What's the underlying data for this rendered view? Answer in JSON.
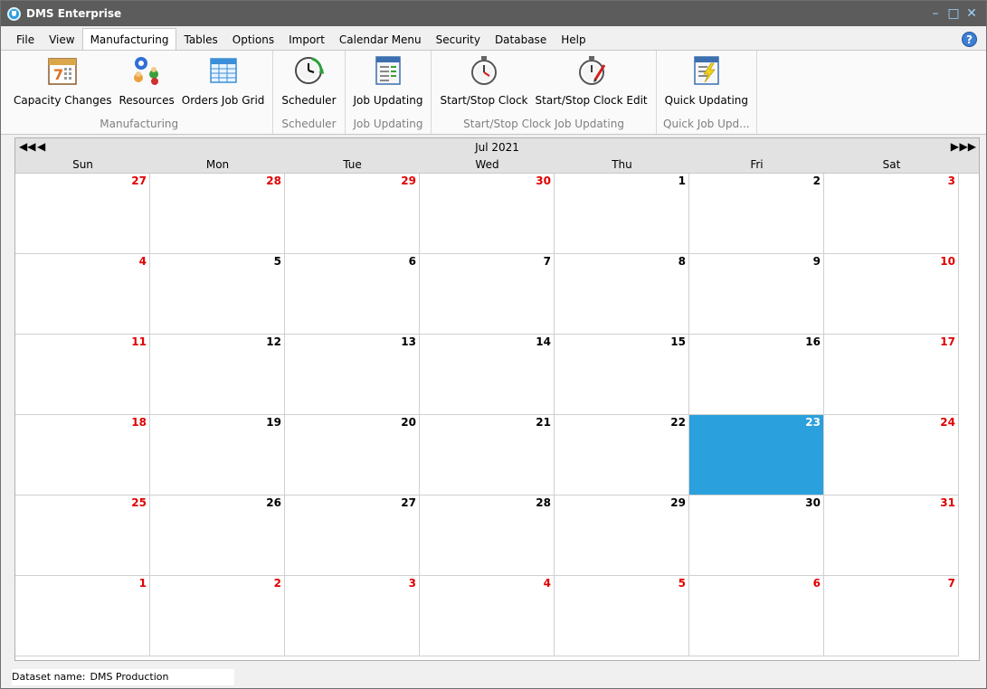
{
  "window": {
    "title": "DMS Enterprise"
  },
  "menu": [
    {
      "key": "file",
      "label": "File"
    },
    {
      "key": "view",
      "label": "View"
    },
    {
      "key": "manufacturing",
      "label": "Manufacturing",
      "active": true
    },
    {
      "key": "tables",
      "label": "Tables"
    },
    {
      "key": "options",
      "label": "Options"
    },
    {
      "key": "import",
      "label": "Import"
    },
    {
      "key": "calendar-menu",
      "label": "Calendar Menu"
    },
    {
      "key": "security",
      "label": "Security"
    },
    {
      "key": "database",
      "label": "Database"
    },
    {
      "key": "help",
      "label": "Help"
    }
  ],
  "ribbon": {
    "groups": [
      {
        "label": "Manufacturing",
        "buttons": [
          {
            "name": "capacity-changes",
            "label": "Capacity Changes",
            "icon": "calendar-icon"
          },
          {
            "name": "resources",
            "label": "Resources",
            "icon": "gears-people-icon"
          },
          {
            "name": "orders-job-grid",
            "label": "Orders Job Grid",
            "icon": "grid-icon"
          }
        ]
      },
      {
        "label": "Scheduler",
        "buttons": [
          {
            "name": "scheduler",
            "label": "Scheduler",
            "icon": "clock-arrow-icon"
          }
        ]
      },
      {
        "label": "Job Updating",
        "buttons": [
          {
            "name": "job-updating",
            "label": "Job Updating",
            "icon": "document-list-icon"
          }
        ]
      },
      {
        "label": "Start/Stop Clock Job Updating",
        "buttons": [
          {
            "name": "start-stop-clock",
            "label": "Start/Stop Clock",
            "icon": "stopwatch-icon"
          },
          {
            "name": "start-stop-clock-edit",
            "label": "Start/Stop Clock Edit",
            "icon": "stopwatch-edit-icon"
          }
        ]
      },
      {
        "label": "Quick Job Upd...",
        "buttons": [
          {
            "name": "quick-updating",
            "label": "Quick Updating",
            "icon": "lightning-document-icon"
          }
        ]
      }
    ]
  },
  "calendar": {
    "month_label": "Jul 2021",
    "days_of_week": [
      "Sun",
      "Mon",
      "Tue",
      "Wed",
      "Thu",
      "Fri",
      "Sat"
    ],
    "weeks": [
      [
        {
          "d": "27",
          "red": true
        },
        {
          "d": "28",
          "red": true
        },
        {
          "d": "29",
          "red": true
        },
        {
          "d": "30",
          "red": true
        },
        {
          "d": "1"
        },
        {
          "d": "2"
        },
        {
          "d": "3",
          "red": true
        }
      ],
      [
        {
          "d": "4",
          "red": true
        },
        {
          "d": "5"
        },
        {
          "d": "6"
        },
        {
          "d": "7"
        },
        {
          "d": "8"
        },
        {
          "d": "9"
        },
        {
          "d": "10",
          "red": true
        }
      ],
      [
        {
          "d": "11",
          "red": true
        },
        {
          "d": "12"
        },
        {
          "d": "13"
        },
        {
          "d": "14"
        },
        {
          "d": "15"
        },
        {
          "d": "16"
        },
        {
          "d": "17",
          "red": true
        }
      ],
      [
        {
          "d": "18",
          "red": true
        },
        {
          "d": "19"
        },
        {
          "d": "20"
        },
        {
          "d": "21"
        },
        {
          "d": "22"
        },
        {
          "d": "23",
          "today": true
        },
        {
          "d": "24",
          "red": true
        }
      ],
      [
        {
          "d": "25",
          "red": true
        },
        {
          "d": "26"
        },
        {
          "d": "27"
        },
        {
          "d": "28"
        },
        {
          "d": "29"
        },
        {
          "d": "30"
        },
        {
          "d": "31",
          "red": true
        }
      ],
      [
        {
          "d": "1",
          "red": true
        },
        {
          "d": "2",
          "red": true
        },
        {
          "d": "3",
          "red": true
        },
        {
          "d": "4",
          "red": true
        },
        {
          "d": "5",
          "red": true
        },
        {
          "d": "6",
          "red": true
        },
        {
          "d": "7",
          "red": true
        }
      ]
    ],
    "today_color": "#2aa0dc",
    "red_color": "#e00000"
  },
  "status": {
    "label": "Dataset name:",
    "value": "DMS Production"
  }
}
